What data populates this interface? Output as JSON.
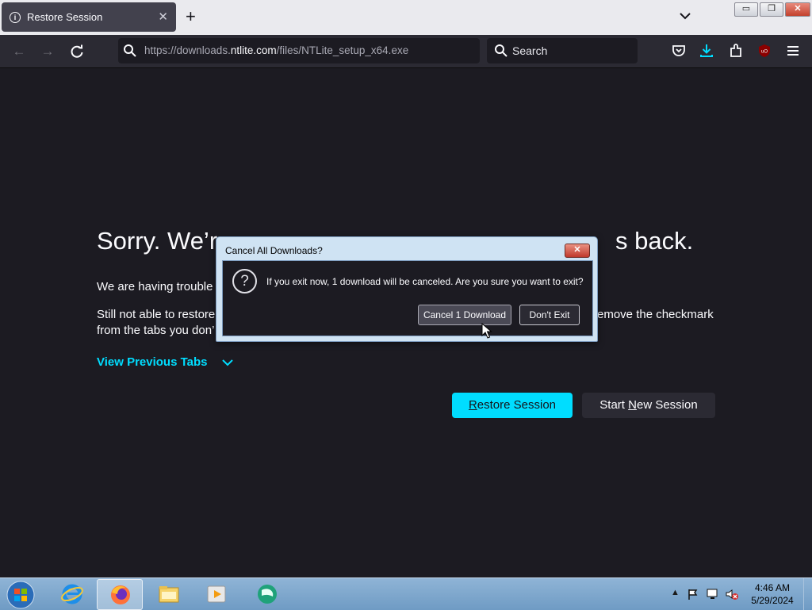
{
  "tab": {
    "title": "Restore Session",
    "close_icon": "✕"
  },
  "toolbar": {
    "url_prefix": "https://downloads.",
    "url_domain": "ntlite.com",
    "url_path": "/files/NTLite_setup_x64.exe",
    "search_placeholder": "Search"
  },
  "page": {
    "headline_left": "Sorry. We’r",
    "headline_right": "s back.",
    "para1": "We are having trouble",
    "para2_left_line1": "Still not able to restore",
    "para2_right_line1": "emove the checkmark",
    "para2_line2": "from the tabs you don’",
    "view_previous": "View Previous Tabs",
    "restore_first": "R",
    "restore_rest": "estore Session",
    "new_session_a": "Start ",
    "new_session_u": "N",
    "new_session_b": "ew Session"
  },
  "dialog": {
    "title": "Cancel All Downloads?",
    "message": "If you exit now, 1 download will be canceled. Are you sure you want to exit?",
    "cancel_label": "Cancel 1 Download",
    "dont_exit_label": "Don't Exit"
  },
  "clock": {
    "time": "4:46 AM",
    "date": "5/29/2024"
  },
  "colors": {
    "accent": "#00ddff",
    "page_bg": "#1c1b22",
    "toolbar_bg": "#2b2a33"
  }
}
